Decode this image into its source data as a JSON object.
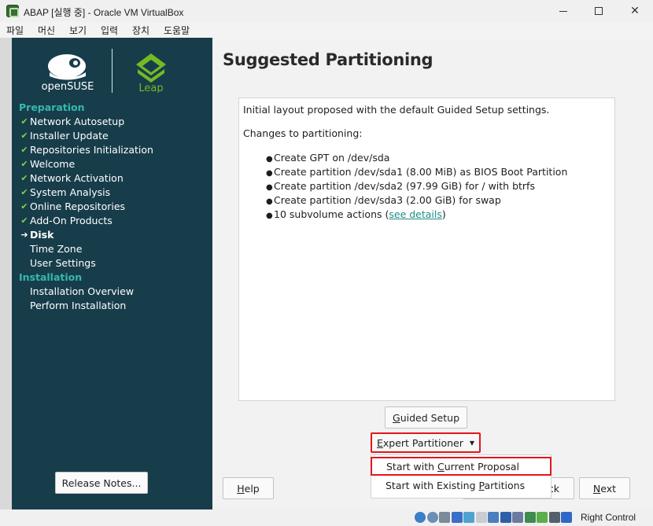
{
  "window": {
    "title": "ABAP [실행 중] - Oracle VM VirtualBox",
    "minimize_icon": "minimize-icon",
    "maximize_icon": "maximize-icon",
    "close_label": "✕"
  },
  "menubar": {
    "items": [
      "파일",
      "머신",
      "보기",
      "입력",
      "장치",
      "도움말"
    ]
  },
  "sidebar": {
    "logo_brand": "openSUSE",
    "logo_product": "Leap",
    "steps": [
      {
        "label": "Preparation",
        "kind": "section"
      },
      {
        "label": "Network Autosetup",
        "kind": "done",
        "mark": "✔"
      },
      {
        "label": "Installer Update",
        "kind": "done",
        "mark": "✔"
      },
      {
        "label": "Repositories Initialization",
        "kind": "done",
        "mark": "✔"
      },
      {
        "label": "Welcome",
        "kind": "done",
        "mark": "✔"
      },
      {
        "label": "Network Activation",
        "kind": "done",
        "mark": "✔"
      },
      {
        "label": "System Analysis",
        "kind": "done",
        "mark": "✔"
      },
      {
        "label": "Online Repositories",
        "kind": "done",
        "mark": "✔"
      },
      {
        "label": "Add-On Products",
        "kind": "done",
        "mark": "✔"
      },
      {
        "label": "Disk",
        "kind": "current",
        "mark": "➔"
      },
      {
        "label": "Time Zone",
        "kind": "todo",
        "mark": ""
      },
      {
        "label": "User Settings",
        "kind": "todo",
        "mark": ""
      },
      {
        "label": "Installation",
        "kind": "section"
      },
      {
        "label": "Installation Overview",
        "kind": "todo",
        "mark": ""
      },
      {
        "label": "Perform Installation",
        "kind": "todo",
        "mark": ""
      }
    ],
    "release_notes_label": "Release Notes..."
  },
  "main": {
    "title": "Suggested Partitioning",
    "intro": "Initial layout proposed with the default Guided Setup settings.",
    "changes_heading": "Changes to partitioning:",
    "bullet": "●",
    "changes": [
      "Create GPT on /dev/sda",
      "Create partition /dev/sda1 (8.00 MiB) as BIOS Boot Partition",
      "Create partition /dev/sda2 (97.99 GiB) for / with btrfs",
      "Create partition /dev/sda3 (2.00 GiB) for swap"
    ],
    "subvolume_prefix": "10 subvolume actions (",
    "subvolume_link": "see details",
    "subvolume_suffix": ")",
    "guided_setup": {
      "mnemonic": "G",
      "rest": "uided Setup"
    },
    "expert_partitioner": {
      "pre": "E",
      "rest": "xpert Partitioner",
      "caret": "▼"
    },
    "dropdown": {
      "item1": {
        "pre": "Start with ",
        "mnemonic": "C",
        "rest": "urrent Proposal"
      },
      "item2": {
        "pre": "Start with Existing ",
        "mnemonic": "P",
        "rest": "artitions"
      }
    },
    "help": {
      "mnemonic": "H",
      "rest": "elp"
    },
    "back_visible": "ck",
    "next": {
      "mnemonic": "N",
      "rest": "ext"
    }
  },
  "statusbar": {
    "host_key": "Right Control",
    "icons": [
      "hard-disk-icon",
      "optical-drive-icon",
      "audio-icon",
      "network-icon",
      "usb-icon",
      "shared-folders-icon",
      "display-icon",
      "capture-icon",
      "video-capture-icon",
      "recording-icon",
      "cpu-icon",
      "mouse-integration-icon",
      "host-key-arrow-icon"
    ],
    "colors": [
      "#3b7fc4",
      "#6a8fb5",
      "#7b8a99",
      "#3a6ec8",
      "#4fa3d1",
      "#c9cdd2",
      "#4a7ebf",
      "#2d5fa8",
      "#6c7aa0",
      "#3f8a4e",
      "#5cae48",
      "#555f6b",
      "#2f67c9"
    ]
  },
  "colors": {
    "sidebar_bg": "#173d4b",
    "section_heading": "#35b9ab",
    "check": "#7ed34a",
    "highlight_box": "#e5151c",
    "link": "#1d8f86"
  }
}
